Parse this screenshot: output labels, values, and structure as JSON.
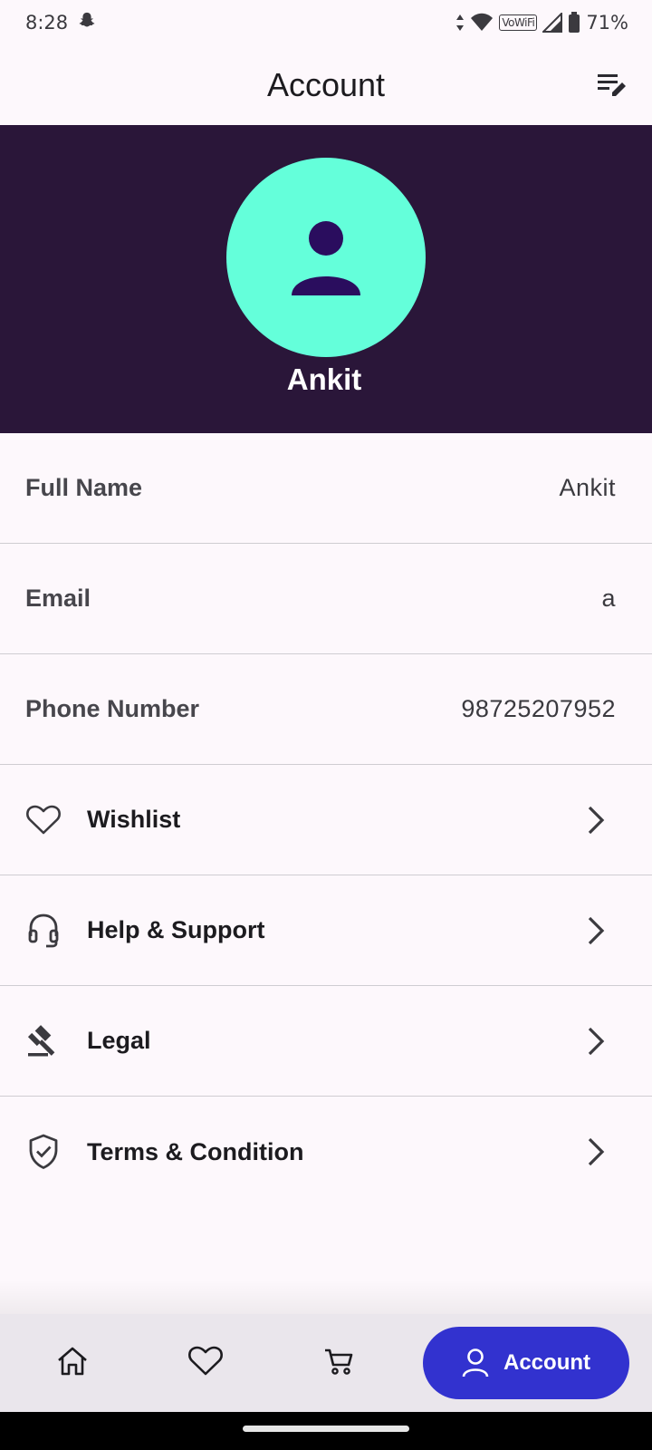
{
  "status_bar": {
    "time": "8:28",
    "battery": "71%",
    "vowifi": "VoWiFi"
  },
  "app_bar": {
    "title": "Account"
  },
  "profile": {
    "name": "Ankit"
  },
  "info_rows": [
    {
      "label": "Full Name",
      "value": "Ankit"
    },
    {
      "label": "Email",
      "value": "a"
    },
    {
      "label": "Phone Number",
      "value": "98725207952"
    }
  ],
  "nav_rows": [
    {
      "label": "Wishlist",
      "icon": "heart-icon"
    },
    {
      "label": "Help & Support",
      "icon": "headset-icon"
    },
    {
      "label": "Legal",
      "icon": "gavel-icon"
    },
    {
      "label": "Terms & Condition",
      "icon": "shield-check-icon"
    }
  ],
  "bottom_nav": {
    "items": [
      "home-icon",
      "heart-icon",
      "cart-icon"
    ],
    "active_label": "Account"
  },
  "colors": {
    "header_bg": "#2a1639",
    "avatar_bg": "#64ffda",
    "avatar_fg": "#2a0d5e",
    "accent": "#3232cf"
  }
}
